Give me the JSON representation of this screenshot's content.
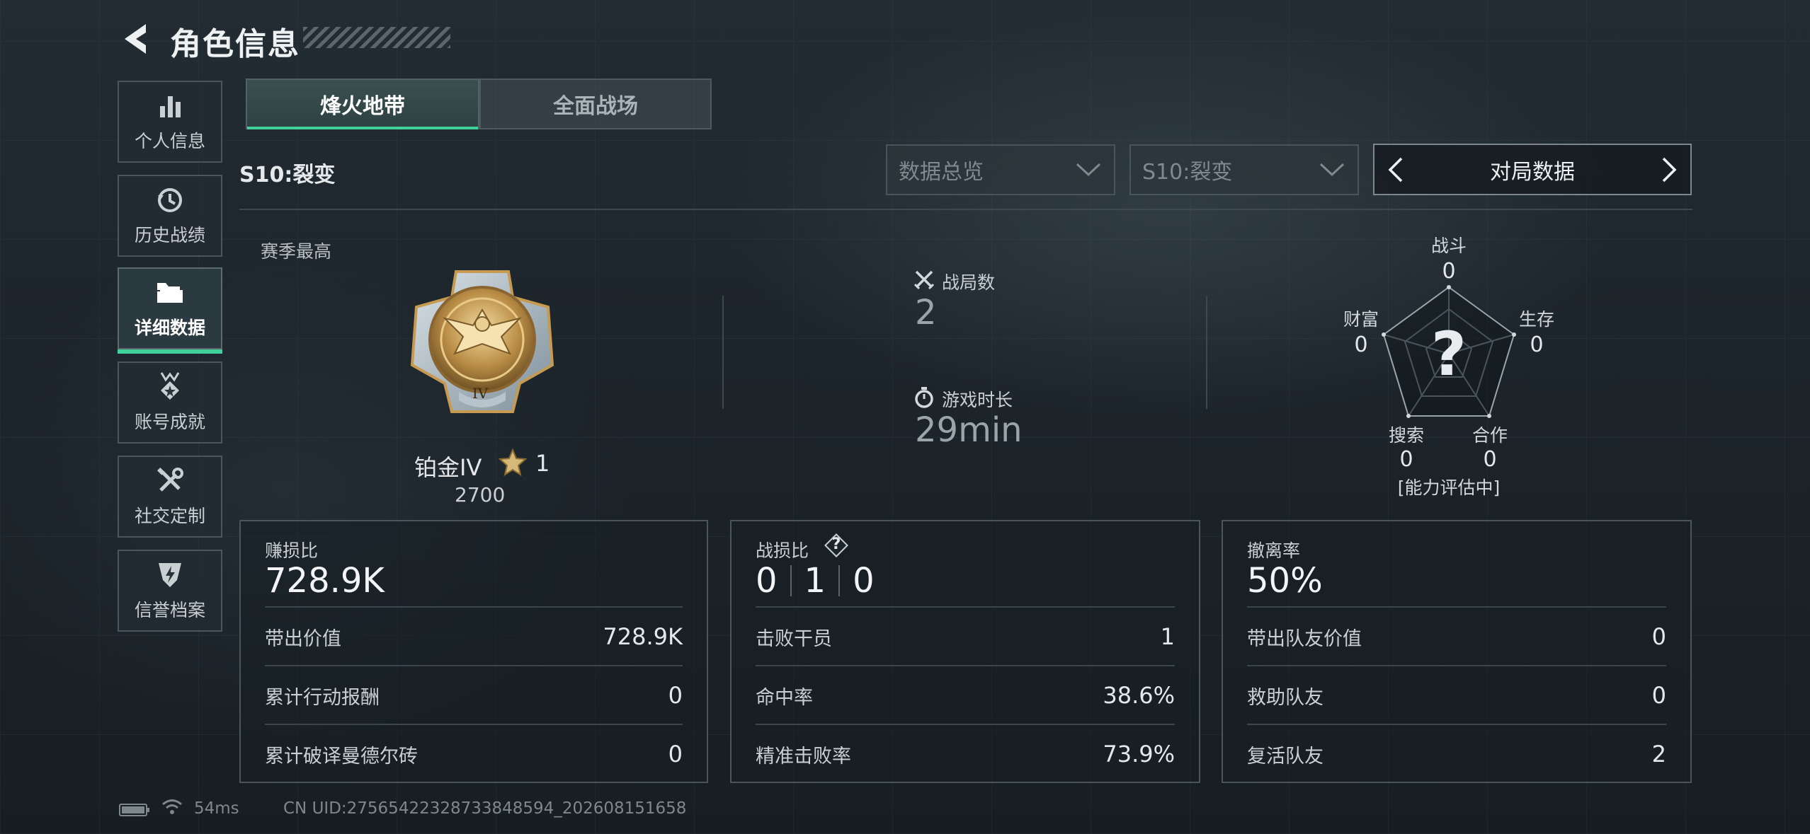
{
  "header": {
    "title": "角色信息"
  },
  "nav": {
    "items": [
      {
        "label": "个人信息",
        "icon": "bar-chart-icon"
      },
      {
        "label": "历史战绩",
        "icon": "clock-history-icon"
      },
      {
        "label": "详细数据",
        "icon": "folder-icon",
        "active": true
      },
      {
        "label": "账号成就",
        "icon": "medal-icon"
      },
      {
        "label": "社交定制",
        "icon": "tools-icon"
      },
      {
        "label": "信誉档案",
        "icon": "shield-bolt-icon"
      }
    ]
  },
  "tabs": [
    {
      "label": "烽火地带",
      "active": true
    },
    {
      "label": "全面战场"
    }
  ],
  "season": {
    "label": "S10:裂变"
  },
  "filters": {
    "overview_placeholder": "数据总览",
    "season_placeholder": "S10:裂变",
    "pager_label": "对局数据"
  },
  "rank": {
    "section_label": "赛季最高",
    "name": "铂金IV",
    "stars": "1",
    "score": "2700",
    "badge_numeral": "IV"
  },
  "matches": {
    "count_label": "战局数",
    "count": "2",
    "time_label": "游戏时长",
    "time": "29min"
  },
  "radar": {
    "center_mark": "?",
    "status": "[能力评估中]",
    "axes": [
      {
        "label": "战斗",
        "value": "0"
      },
      {
        "label": "生存",
        "value": "0"
      },
      {
        "label": "合作",
        "value": "0"
      },
      {
        "label": "搜索",
        "value": "0"
      },
      {
        "label": "财富",
        "value": "0"
      }
    ]
  },
  "panels": [
    {
      "title": "赚损比",
      "big": "728.9K",
      "rows": [
        {
          "label": "带出价值",
          "value": "728.9K"
        },
        {
          "label": "累计行动报酬",
          "value": "0"
        },
        {
          "label": "累计破译曼德尔砖",
          "value": "0"
        }
      ]
    },
    {
      "title": "战损比",
      "help": "?",
      "big_parts": [
        "0",
        "1",
        "0"
      ],
      "rows": [
        {
          "label": "击败干员",
          "value": "1"
        },
        {
          "label": "命中率",
          "value": "38.6%"
        },
        {
          "label": "精准击败率",
          "value": "73.9%"
        }
      ]
    },
    {
      "title": "撤离率",
      "big": "50%",
      "rows": [
        {
          "label": "带出队友价值",
          "value": "0"
        },
        {
          "label": "救助队友",
          "value": "0"
        },
        {
          "label": "复活队友",
          "value": "2"
        }
      ]
    }
  ],
  "footer": {
    "ping": "54ms",
    "uid": "CN UID:275654223287338485​94_202608151658"
  },
  "colors": {
    "accent": "#3fd29a",
    "background": "#1c242b"
  }
}
